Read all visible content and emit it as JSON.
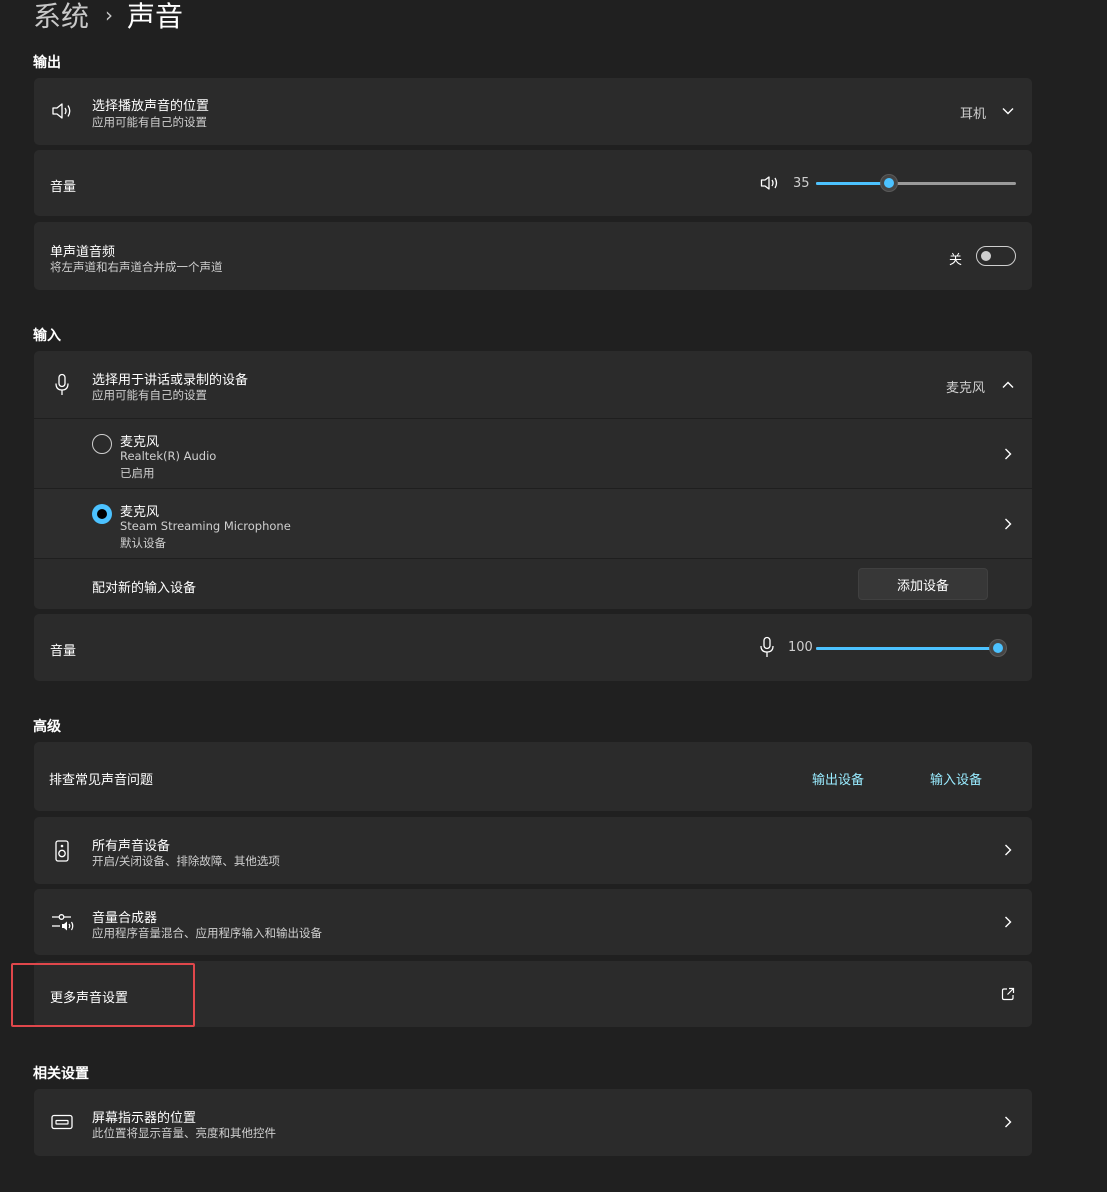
{
  "breadcrumb": {
    "parent": "系统",
    "separator": "›",
    "current": "声音"
  },
  "output": {
    "section_title": "输出",
    "playback": {
      "title": "选择播放声音的位置",
      "subtitle": "应用可能有自己的设置",
      "value": "耳机"
    },
    "volume": {
      "label": "音量",
      "value_text": "35",
      "level_percent": 35
    },
    "mono": {
      "title": "单声道音频",
      "subtitle": "将左声道和右声道合并成一个声道",
      "state_label": "关",
      "on": false
    }
  },
  "input": {
    "section_title": "输入",
    "device_select": {
      "title": "选择用于讲话或录制的设备",
      "subtitle": "应用可能有自己的设置",
      "value": "麦克风"
    },
    "devices": [
      {
        "name": "麦克风",
        "driver": "Realtek(R) Audio",
        "status": "已启用",
        "selected": false
      },
      {
        "name": "麦克风",
        "driver": "Steam Streaming Microphone",
        "status": "默认设备",
        "selected": true
      }
    ],
    "pair": {
      "label": "配对新的输入设备",
      "button": "添加设备"
    },
    "volume": {
      "label": "音量",
      "value_text": "100",
      "level_percent": 100
    }
  },
  "advanced": {
    "section_title": "高级",
    "troubleshoot": {
      "label": "排查常见声音问题",
      "link_output": "输出设备",
      "link_input": "输入设备"
    },
    "all_devices": {
      "title": "所有声音设备",
      "subtitle": "开启/关闭设备、排除故障、其他选项"
    },
    "mixer": {
      "title": "音量合成器",
      "subtitle": "应用程序音量混合、应用程序输入和输出设备"
    },
    "more": {
      "label": "更多声音设置"
    }
  },
  "related": {
    "section_title": "相关设置",
    "indicator": {
      "title": "屏幕指示器的位置",
      "subtitle": "此位置将显示音量、亮度和其他控件"
    }
  },
  "colors": {
    "accent": "#4cc2ff",
    "link": "#99ebff",
    "highlight": "#e0474b",
    "card": "#2b2b2b",
    "background": "#202020"
  }
}
